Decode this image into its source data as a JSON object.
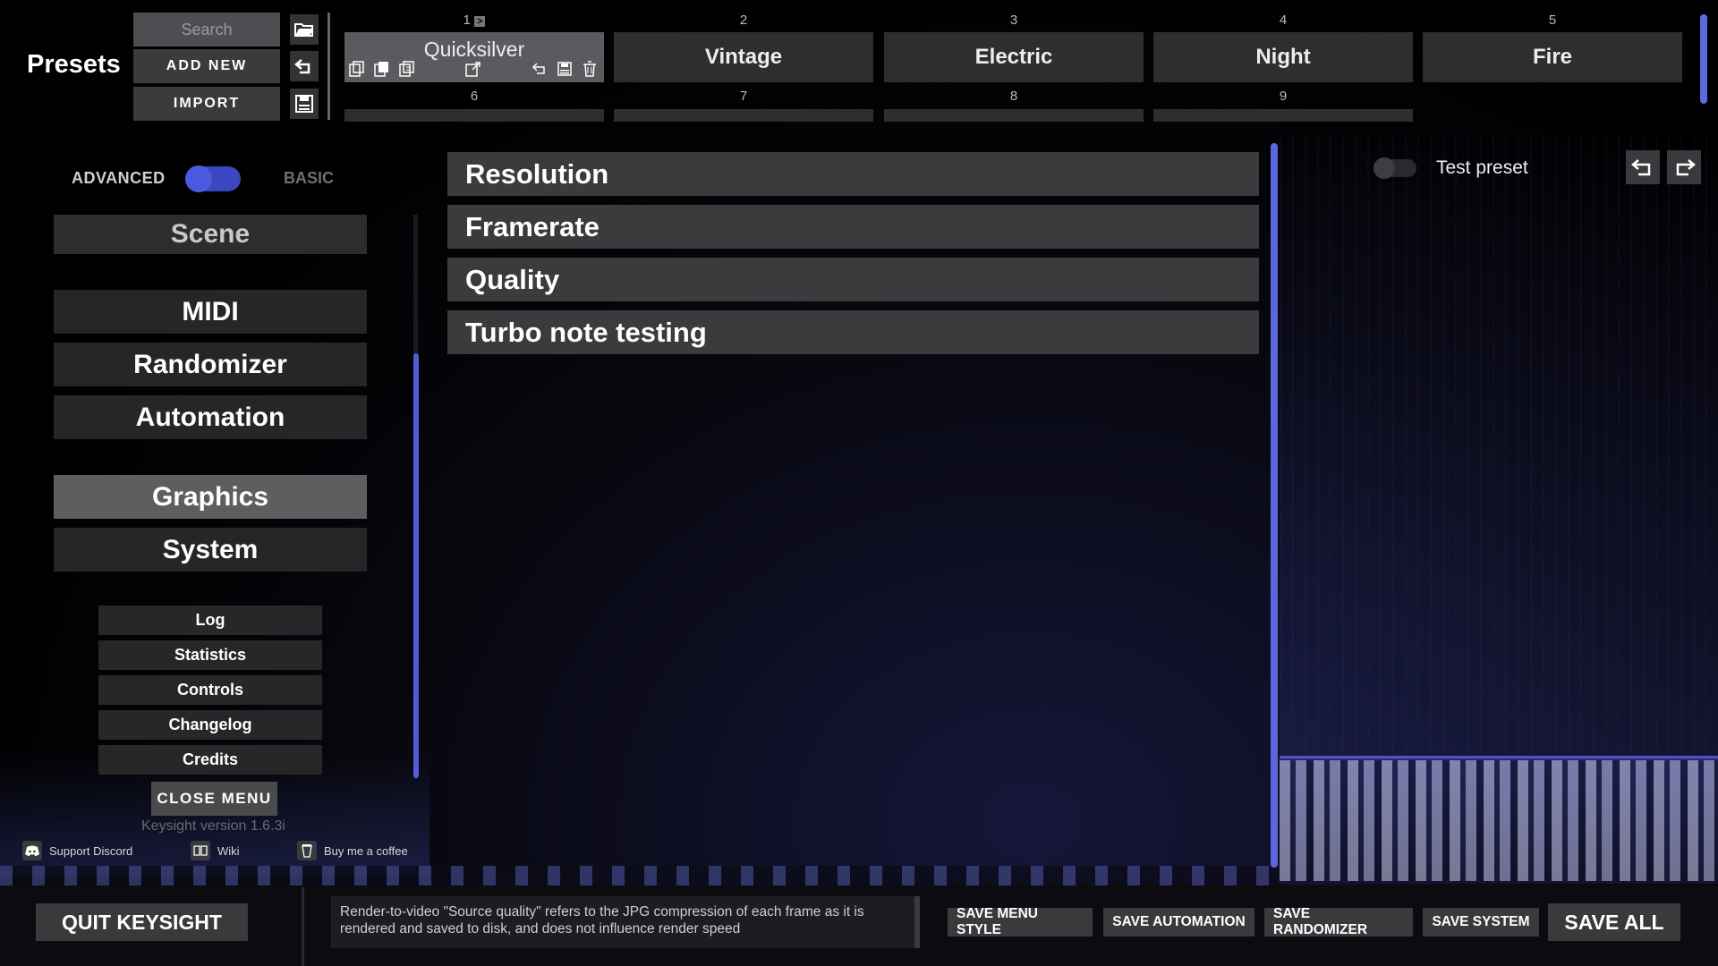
{
  "presets": {
    "title": "Presets",
    "search_placeholder": "Search",
    "add_new": "ADD NEW",
    "import": "IMPORT",
    "slots": [
      {
        "num": "1",
        "name": "Quicksilver"
      },
      {
        "num": "2",
        "name": "Vintage"
      },
      {
        "num": "3",
        "name": "Electric"
      },
      {
        "num": "4",
        "name": "Night"
      },
      {
        "num": "5",
        "name": "Fire"
      }
    ],
    "slots_row2": [
      {
        "num": "6"
      },
      {
        "num": "7"
      },
      {
        "num": "8"
      },
      {
        "num": "9"
      }
    ],
    "play_glyph": ">"
  },
  "mode": {
    "advanced": "ADVANCED",
    "basic": "BASIC"
  },
  "nav": {
    "scene": "Scene",
    "midi": "MIDI",
    "randomizer": "Randomizer",
    "automation": "Automation",
    "graphics": "Graphics",
    "system": "System"
  },
  "misc": {
    "log": "Log",
    "statistics": "Statistics",
    "controls": "Controls",
    "changelog": "Changelog",
    "credits": "Credits"
  },
  "close_menu": "CLOSE MENU",
  "version": "Keysight version 1.6.3i",
  "links": {
    "discord": "Support Discord",
    "wiki": "Wiki",
    "coffee": "Buy me a coffee"
  },
  "sections": [
    "Resolution",
    "Framerate",
    "Quality",
    "Turbo note testing"
  ],
  "test_preset": "Test preset",
  "bottom": {
    "quit": "QUIT KEYSIGHT",
    "hint": "Render-to-video \"Source quality\" refers to the JPG compression of each frame as it is rendered and saved to disk, and does not influence render speed",
    "save_menu_style": "SAVE MENU STYLE",
    "save_automation": "SAVE AUTOMATION",
    "save_randomizer": "SAVE RANDOMIZER",
    "save_system": "SAVE SYSTEM",
    "save_all": "SAVE ALL"
  },
  "colors": {
    "accent": "#4f5ed6",
    "panel": "#252627",
    "selected": "#5d5e60"
  }
}
